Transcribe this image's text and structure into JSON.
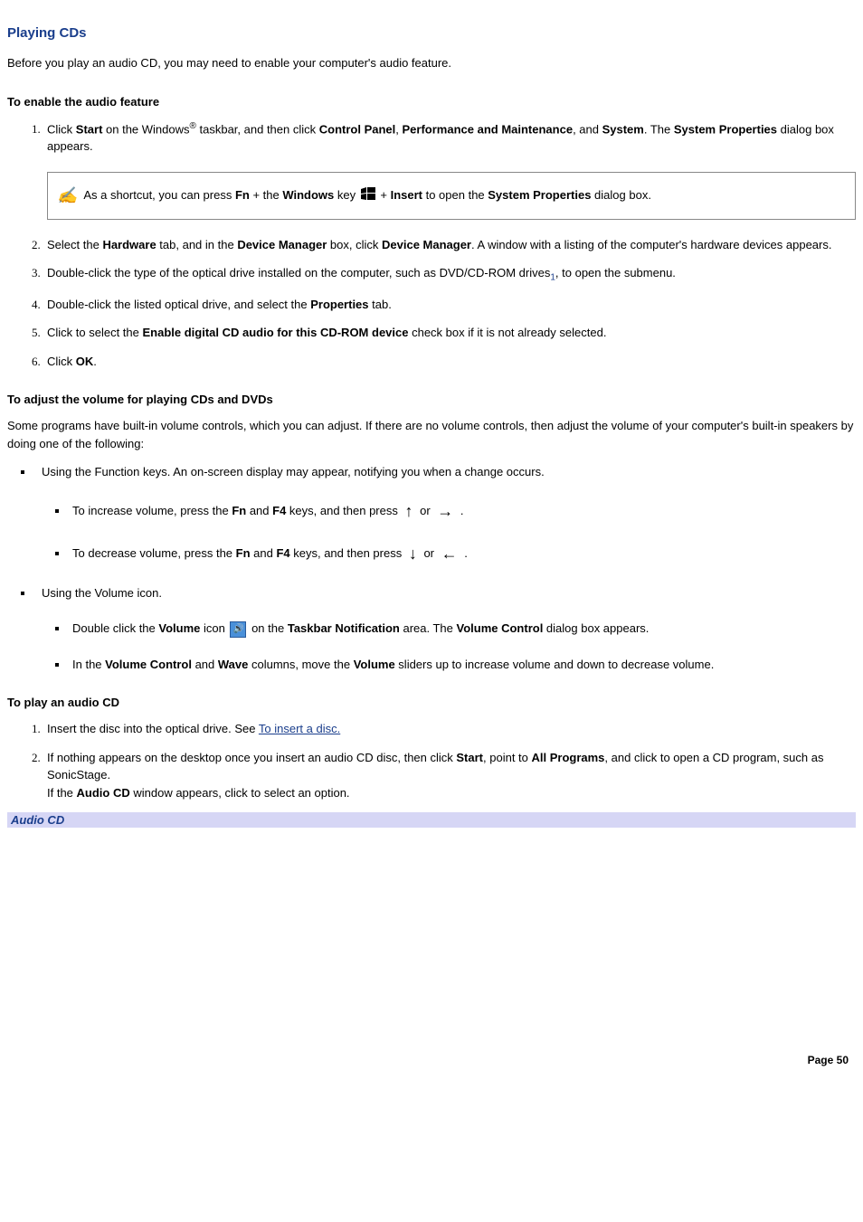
{
  "title": "Playing CDs",
  "intro": "Before you play an audio CD, you may need to enable your computer's audio feature.",
  "section_enable": {
    "heading": "To enable the audio feature",
    "step1": {
      "pre": "Click ",
      "b1": "Start",
      "mid1": " on the Windows",
      "reg": "®",
      "mid2": " taskbar, and then click ",
      "b2": "Control Panel",
      "c1": ", ",
      "b3": "Performance and Maintenance",
      "c2": ", and ",
      "b4": "System",
      "end": ". The ",
      "b5": "System Properties",
      "tail": " dialog box appears."
    },
    "note": {
      "pre": " As a shortcut, you can press ",
      "b1": "Fn",
      "mid1": " + the ",
      "b2": "Windows",
      "mid2": " key ",
      "mid3": " + ",
      "b3": "Insert",
      "mid4": " to open the ",
      "b4": "System Properties",
      "tail": " dialog box."
    },
    "step2": {
      "pre": "Select the ",
      "b1": "Hardware",
      "mid1": " tab, and in the ",
      "b2": "Device Manager",
      "mid2": " box, click ",
      "b3": "Device Manager",
      "tail": ". A window with a listing of the computer's hardware devices appears."
    },
    "step3": {
      "pre": "Double-click the type of the optical drive installed on the computer, such as DVD/CD-ROM drives",
      "ref": "1",
      "tail": ", to open the submenu."
    },
    "step4": {
      "pre": "Double-click the listed optical drive, and select the ",
      "b1": "Properties",
      "tail": " tab."
    },
    "step5": {
      "pre": "Click to select the ",
      "b1": "Enable digital CD audio for this CD-ROM device",
      "tail": " check box if it is not already selected."
    },
    "step6": {
      "pre": "Click ",
      "b1": "OK",
      "tail": "."
    }
  },
  "section_volume": {
    "heading": "To adjust the volume for playing CDs and DVDs",
    "intro": "Some programs have built-in volume controls, which you can adjust. If there are no volume controls, then adjust the volume of your computer's built-in speakers by doing one of the following:",
    "b1_text": "Using the Function keys. An on-screen display may appear, notifying you when a change occurs.",
    "inc": {
      "pre": "To increase volume, press the ",
      "b1": "Fn",
      "mid1": " and ",
      "b2": "F4",
      "mid2": " keys, and then press ",
      "or": " or ",
      "tail": " ."
    },
    "dec": {
      "pre": "To decrease volume, press the ",
      "b1": "Fn",
      "mid1": " and ",
      "b2": "F4",
      "mid2": " keys, and then press ",
      "or": " or ",
      "tail": " ."
    },
    "b2_text": "Using the Volume icon.",
    "vicon": {
      "pre": "Double click the ",
      "b1": "Volume",
      "mid1": " icon ",
      "mid2": " on the ",
      "b2": "Taskbar Notification",
      "mid3": " area. The ",
      "b3": "Volume Control",
      "tail": " dialog box appears."
    },
    "vslide": {
      "pre": "In the ",
      "b1": "Volume Control",
      "mid1": " and ",
      "b2": "Wave",
      "mid2": " columns, move the ",
      "b3": "Volume",
      "tail": " sliders up to increase volume and down to decrease volume."
    }
  },
  "section_play": {
    "heading": "To play an audio CD",
    "step1": {
      "pre": "Insert the disc into the optical drive. See ",
      "link": "To insert a disc."
    },
    "step2": {
      "pre": "If nothing appears on the desktop once you insert an audio CD disc, then click ",
      "b1": "Start",
      "mid1": ", point to ",
      "b2": "All Programs",
      "mid2": ", and click to open a CD program, such as SonicStage.",
      "line2_pre": "If the ",
      "b3": "Audio CD",
      "line2_tail": " window appears, click to select an option."
    }
  },
  "caption": "Audio CD",
  "footer": "Page 50"
}
